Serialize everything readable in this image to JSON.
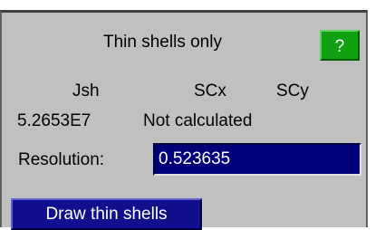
{
  "panel": {
    "title": "Thin shells only",
    "help_label": "?"
  },
  "results": {
    "headers": [
      "Jsh",
      "SCx",
      "SCy"
    ],
    "values": [
      "5.2653E7",
      "Not calculated"
    ]
  },
  "resolution": {
    "label": "Resolution:",
    "value": "0.523635"
  },
  "actions": {
    "draw_label": "Draw thin shells"
  },
  "colors": {
    "panel_bg": "#c0c0c0",
    "help_button": "#10a010",
    "input_bg": "#00007a",
    "action_button": "#10108e"
  },
  "icons": {
    "help": "help-icon"
  }
}
